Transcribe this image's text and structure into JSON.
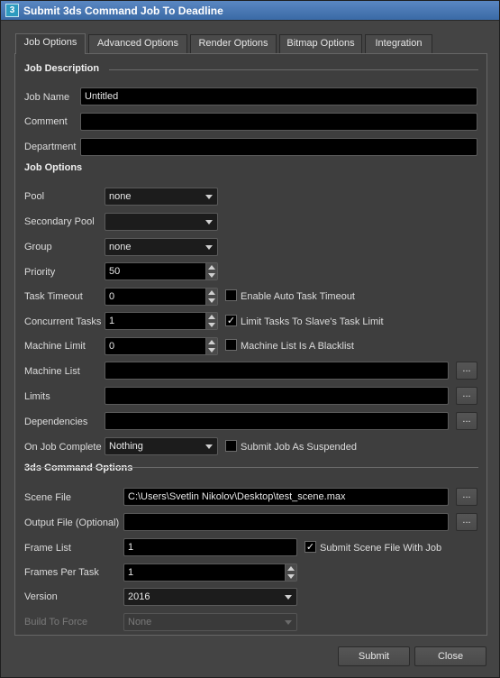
{
  "window": {
    "title": "Submit 3ds Command Job To Deadline",
    "icon_text": "3",
    "close_glyph": "✕"
  },
  "tabs": [
    {
      "label": "Job Options"
    },
    {
      "label": "Advanced Options"
    },
    {
      "label": "Render Options"
    },
    {
      "label": "Bitmap Options"
    },
    {
      "label": "Integration"
    }
  ],
  "job_description": {
    "heading": "Job Description",
    "job_name_label": "Job Name",
    "job_name_value": "Untitled",
    "comment_label": "Comment",
    "comment_value": "",
    "department_label": "Department",
    "department_value": ""
  },
  "job_options": {
    "heading": "Job Options",
    "pool_label": "Pool",
    "pool_value": "none",
    "secondary_pool_label": "Secondary Pool",
    "secondary_pool_value": "",
    "group_label": "Group",
    "group_value": "none",
    "priority_label": "Priority",
    "priority_value": "50",
    "task_timeout_label": "Task Timeout",
    "task_timeout_value": "0",
    "auto_task_timeout_label": "Enable Auto Task Timeout",
    "auto_task_timeout_checked": false,
    "concurrent_tasks_label": "Concurrent Tasks",
    "concurrent_tasks_value": "1",
    "limit_tasks_label": "Limit Tasks To Slave's Task Limit",
    "limit_tasks_checked": true,
    "machine_limit_label": "Machine Limit",
    "machine_limit_value": "0",
    "blacklist_label": "Machine List Is A Blacklist",
    "blacklist_checked": false,
    "machine_list_label": "Machine List",
    "machine_list_value": "",
    "limits_label": "Limits",
    "limits_value": "",
    "dependencies_label": "Dependencies",
    "dependencies_value": "",
    "on_complete_label": "On Job Complete",
    "on_complete_value": "Nothing",
    "suspended_label": "Submit Job As Suspended",
    "suspended_checked": false,
    "browse_label": "..."
  },
  "command_options": {
    "heading": "3ds Command Options",
    "scene_file_label": "Scene File",
    "scene_file_value": "C:\\Users\\Svetlin Nikolov\\Desktop\\test_scene.max",
    "output_file_label": "Output File (Optional)",
    "output_file_value": "",
    "frame_list_label": "Frame List",
    "frame_list_value": "1",
    "submit_scene_label": "Submit Scene File With Job",
    "submit_scene_checked": true,
    "frames_per_task_label": "Frames Per Task",
    "frames_per_task_value": "1",
    "version_label": "Version",
    "version_value": "2016",
    "build_label": "Build To Force",
    "build_value": "None"
  },
  "footer": {
    "submit_label": "Submit",
    "close_label": "Close"
  },
  "check_glyph": "✓"
}
